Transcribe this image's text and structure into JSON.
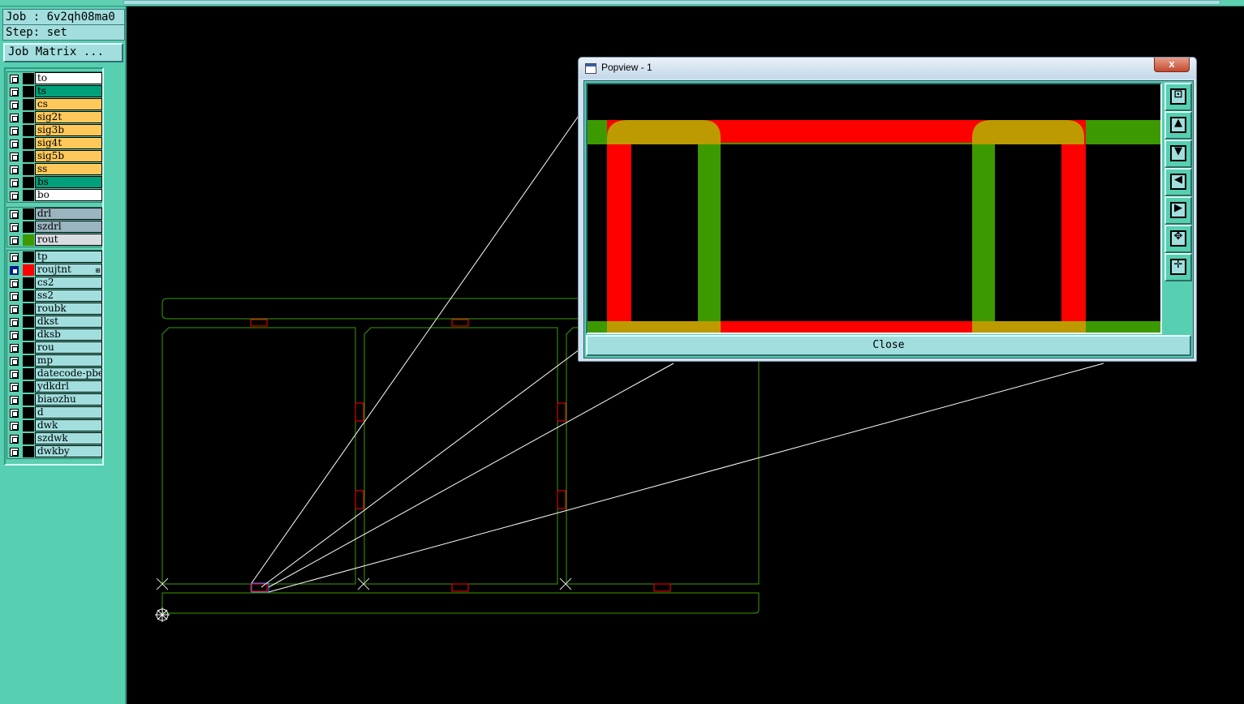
{
  "job": {
    "job_line": "Job : 6v2qh08ma0",
    "step_line": "Step: set",
    "matrix_button": "Job Matrix ..."
  },
  "layers": {
    "board": [
      {
        "name": "to",
        "color": "#ffffff"
      },
      {
        "name": "ts",
        "color": "#00a07a"
      },
      {
        "name": "cs",
        "color": "#ffc85a"
      },
      {
        "name": "sig2t",
        "color": "#ffc85a"
      },
      {
        "name": "sig3b",
        "color": "#ffc85a"
      },
      {
        "name": "sig4t",
        "color": "#ffc85a"
      },
      {
        "name": "sig5b",
        "color": "#ffc85a"
      },
      {
        "name": "ss",
        "color": "#ffc85a"
      },
      {
        "name": "bs",
        "color": "#00a07a"
      },
      {
        "name": "bo",
        "color": "#ffffff"
      }
    ],
    "drill": [
      {
        "name": "drl",
        "color": "#9bb4bf"
      },
      {
        "name": "szdrl",
        "color": "#9bb4bf"
      },
      {
        "name": "rout",
        "color": "#d9dde1",
        "swatch": "#3c9a00"
      }
    ],
    "misc": [
      {
        "name": "tp",
        "color": "#a2dede"
      },
      {
        "name": "roujtnt",
        "color": "#a2dede",
        "swatch": "#ff0000",
        "selected": true,
        "mark": "⊞"
      },
      {
        "name": "cs2",
        "color": "#a2dede"
      },
      {
        "name": "ss2",
        "color": "#a2dede"
      },
      {
        "name": "roubk",
        "color": "#a2dede"
      },
      {
        "name": "dkst",
        "color": "#a2dede"
      },
      {
        "name": "dksb",
        "color": "#a2dede"
      },
      {
        "name": "rou",
        "color": "#a2dede"
      },
      {
        "name": "mp",
        "color": "#a2dede"
      },
      {
        "name": "datecode-pbe",
        "color": "#a2dede"
      },
      {
        "name": "ydkdrl",
        "color": "#a2dede"
      },
      {
        "name": "biaozhu",
        "color": "#a2dede"
      },
      {
        "name": "d",
        "color": "#a2dede"
      },
      {
        "name": "dwk",
        "color": "#a2dede"
      },
      {
        "name": "szdwk",
        "color": "#a2dede"
      },
      {
        "name": "dwkby",
        "color": "#a2dede"
      }
    ]
  },
  "popview": {
    "title": "Popview - 1",
    "close_label": "Close",
    "close_x": "x",
    "tools": [
      {
        "name": "fit-icon",
        "glyph": "⊡"
      },
      {
        "name": "pan-up-icon",
        "glyph": "▲"
      },
      {
        "name": "pan-down-icon",
        "glyph": "▼"
      },
      {
        "name": "pan-left-icon",
        "glyph": "◀"
      },
      {
        "name": "pan-right-icon",
        "glyph": "▶"
      },
      {
        "name": "zoom-out-icon",
        "glyph": "✥"
      },
      {
        "name": "zoom-in-icon",
        "glyph": "✛"
      }
    ]
  },
  "colors": {
    "panel": "#57cfb1",
    "field": "#a2dede",
    "outline": "#3c9a00",
    "tab": "#ff0000"
  }
}
